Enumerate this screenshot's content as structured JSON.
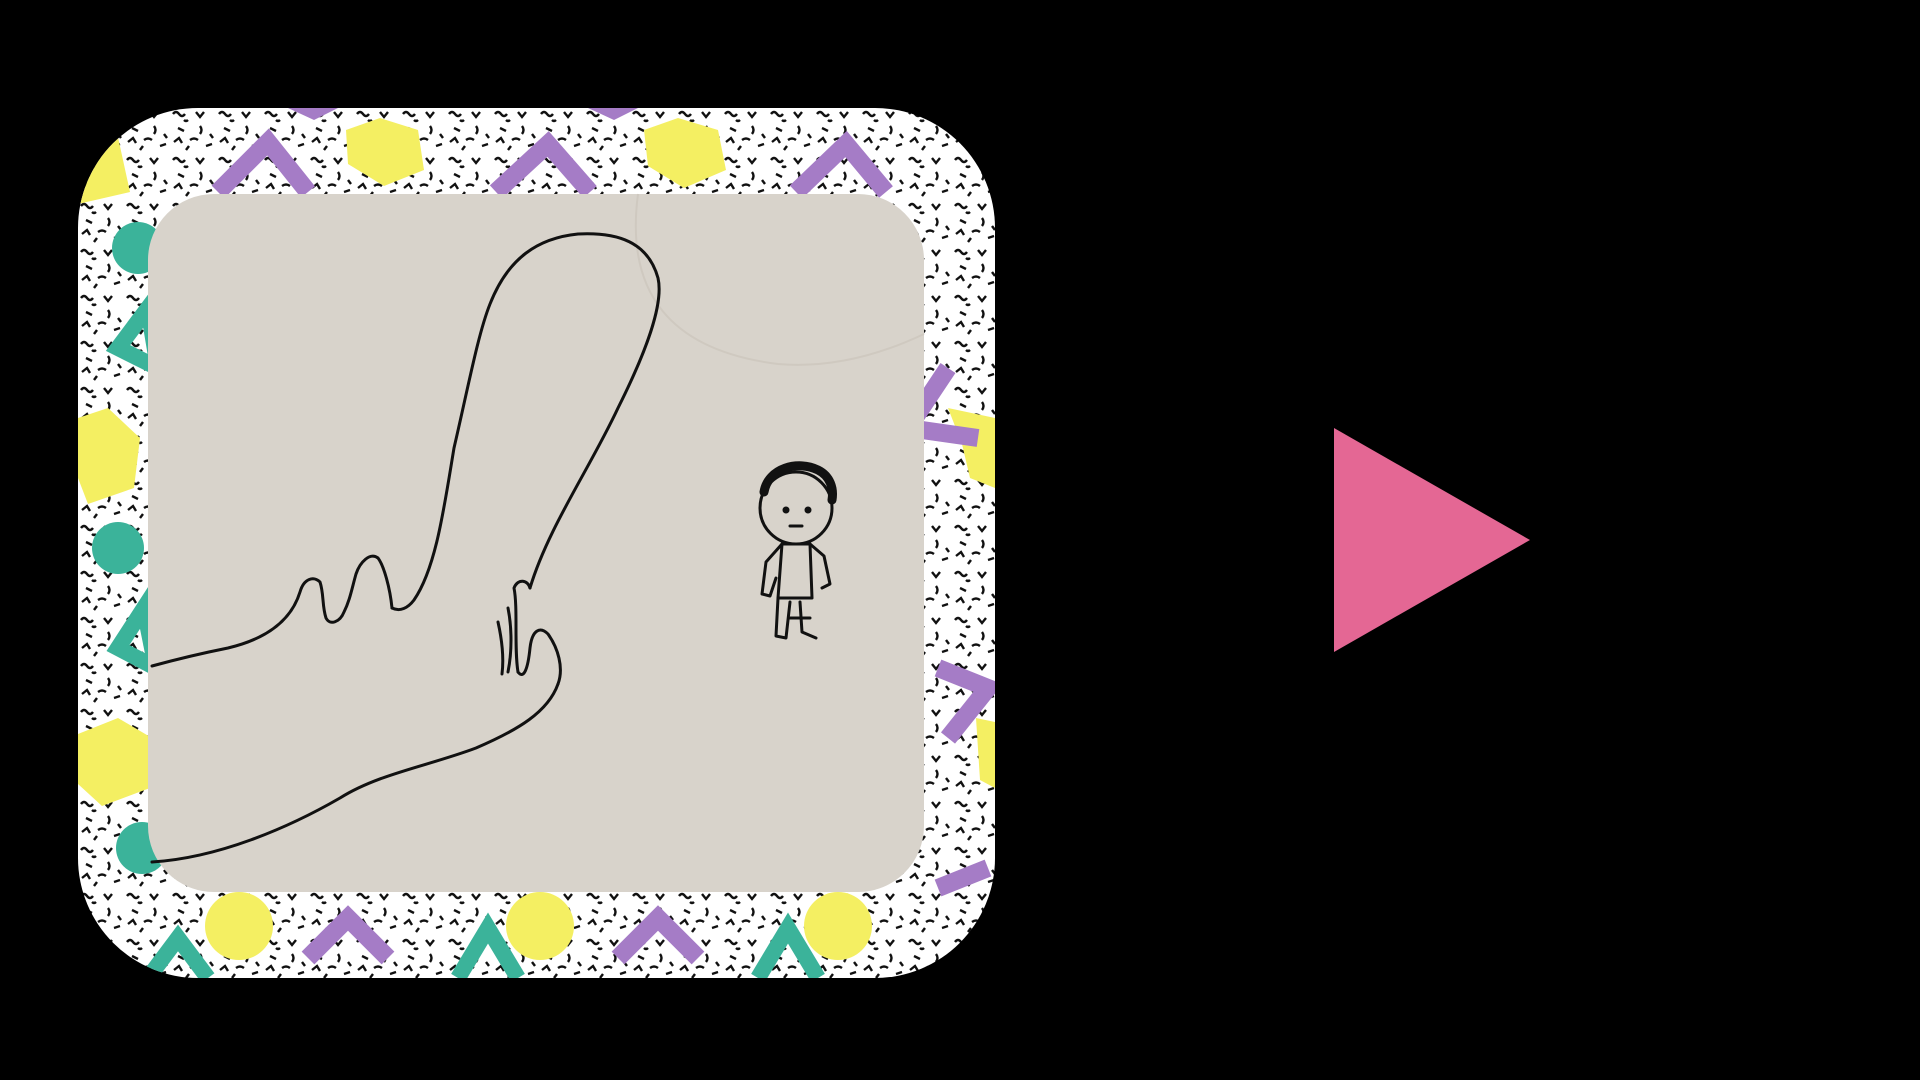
{
  "scene": {
    "background_color": "#000000",
    "app_icon": {
      "description_name": "memphis-pattern-frame-with-drawing",
      "frame_colors": {
        "base": "#ffffff",
        "squiggle": "#111111",
        "yellow": "#f4ef62",
        "purple": "#a57cc6",
        "teal": "#3bb39a"
      },
      "drawing": {
        "paper_color": "#d8d3cb",
        "ink_color": "#111111",
        "subjects": [
          "giant-hand",
          "small-boy"
        ]
      }
    },
    "play_button": {
      "icon": "play-triangle-icon",
      "color": "#e46794"
    }
  }
}
